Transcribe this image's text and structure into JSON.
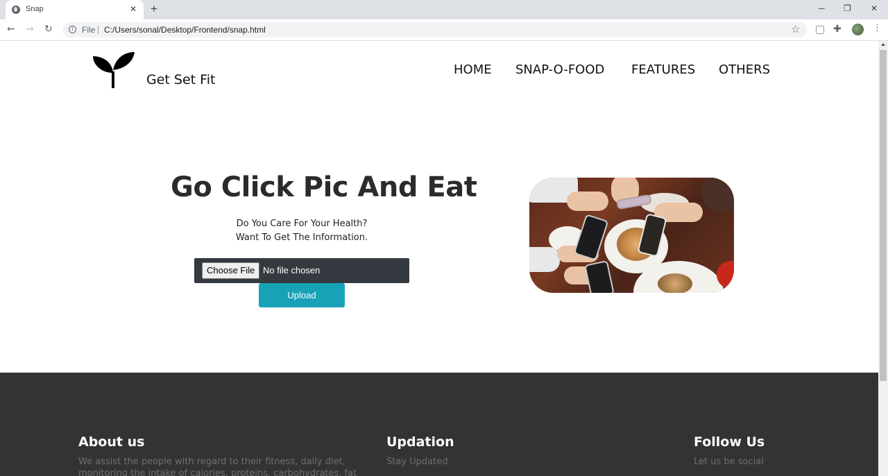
{
  "browser": {
    "tab_title": "Snap",
    "tab_close": "✕",
    "new_tab": "+",
    "window_controls": {
      "minimize": "─",
      "maximize": "❐",
      "close": "✕"
    },
    "nav": {
      "back": "←",
      "forward": "→",
      "reload": "↻"
    },
    "address": {
      "scheme": "File",
      "url": "C:/Users/sonal/Desktop/Frontend/snap.html"
    },
    "icons": {
      "bookmark": "star-icon",
      "extension": "puzzle-icon",
      "menu": "⋮"
    }
  },
  "header": {
    "brand": "Get Set Fit",
    "logo": "sprout-icon",
    "nav": [
      "HOME",
      "SNAP-O-FOOD",
      "FEATURES",
      "OTHERS"
    ]
  },
  "hero": {
    "title": "Go Click Pic And Eat",
    "line1": "Do You Care For Your Health?",
    "line2": "Want To Get The Information.",
    "file_button": "Choose File",
    "file_status": "No file chosen",
    "upload": "Upload"
  },
  "footer": {
    "about": {
      "heading": "About us",
      "text": "We assist the people with regard to their fitness, daily diet, monitoring the intake of calories, proteins, carbohydrates, fat and fibre."
    },
    "updation": {
      "heading": "Updation",
      "text": "Stay Updated"
    },
    "follow": {
      "heading": "Follow Us",
      "text": "Let us be social"
    }
  },
  "colors": {
    "upload_button": "#17a2b8",
    "file_box": "#343a40",
    "footer_bg": "#333333",
    "footer_text": "#6f6f6f"
  }
}
